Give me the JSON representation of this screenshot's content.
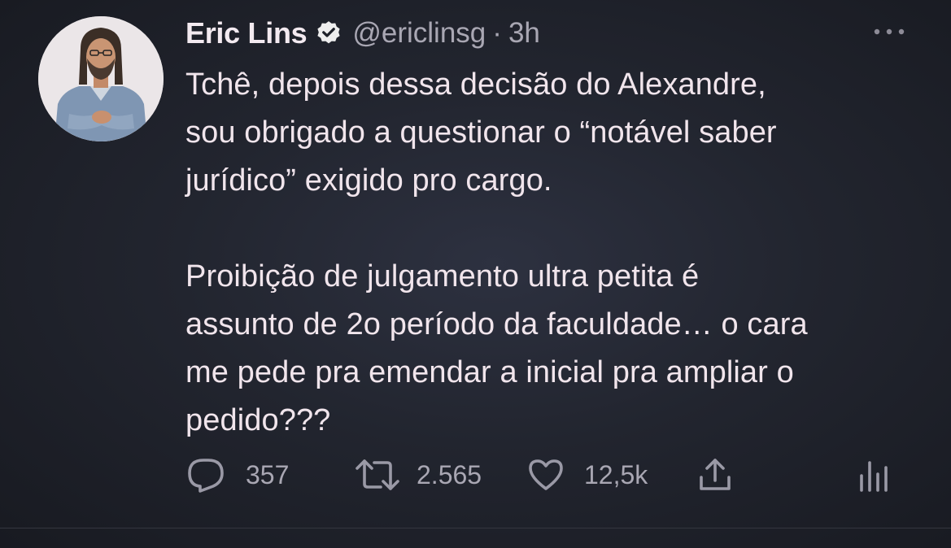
{
  "tweet": {
    "author": {
      "name": "Eric Lins",
      "handle": "@ericlinsg",
      "verified": true,
      "separator": "·",
      "time": "3h"
    },
    "text": "Tchê, depois dessa decisão do Alexandre,\nsou obrigado a questionar o “notável saber\njurídico” exigido pro cargo.\n\nProibição de julgamento ultra petita é\nassunto de 2o período da faculdade… o cara\nme pede pra emendar a inicial pra ampliar o\npedido???",
    "actions": {
      "replies": "357",
      "retweets": "2.565",
      "likes": "12,5k"
    }
  },
  "icons": {
    "more": "more-horizontal-icon",
    "reply": "reply-bubble-icon",
    "retweet": "retweet-icon",
    "like": "heart-icon",
    "share": "share-icon",
    "analytics": "analytics-icon",
    "verified": "verified-badge-icon"
  },
  "colors": {
    "background": "#22252f",
    "text": "#f1e5ec",
    "secondary": "#a9a7b3",
    "icon": "#9a99a6"
  }
}
